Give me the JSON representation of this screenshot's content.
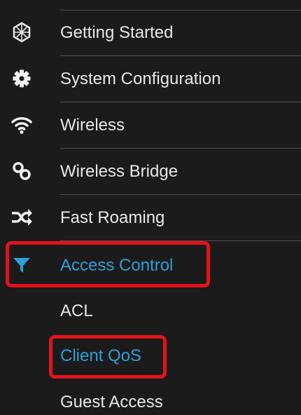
{
  "menu": {
    "items": [
      {
        "label": "Getting Started",
        "icon": "getting-started-icon"
      },
      {
        "label": "System Configuration",
        "icon": "gear-icon"
      },
      {
        "label": "Wireless",
        "icon": "wifi-icon"
      },
      {
        "label": "Wireless Bridge",
        "icon": "bridge-link-icon"
      },
      {
        "label": "Fast Roaming",
        "icon": "shuffle-icon"
      },
      {
        "label": "Access Control",
        "icon": "funnel-icon",
        "active": true
      }
    ],
    "sub_items": [
      {
        "label": "ACL"
      },
      {
        "label": "Client QoS",
        "active": true
      },
      {
        "label": "Guest Access"
      }
    ]
  },
  "colors": {
    "background": "#1b1b1b",
    "text": "#e8e8e8",
    "accent": "#2e9fd6",
    "highlight": "#e3121a"
  }
}
